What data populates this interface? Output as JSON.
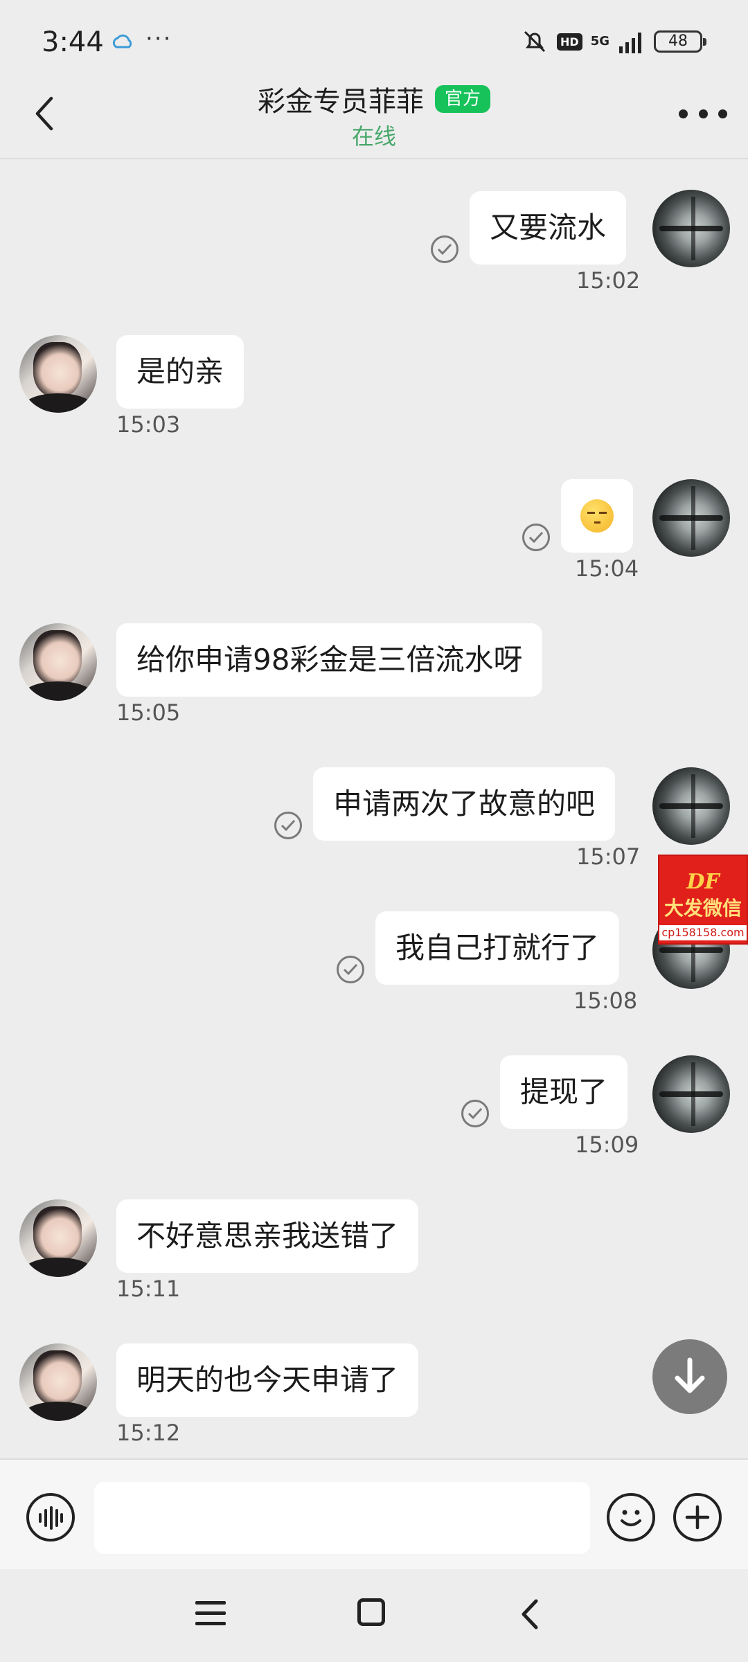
{
  "status_bar": {
    "time": "3:44",
    "dots": "···",
    "hd": "HD",
    "network": "5G",
    "battery": "48"
  },
  "header": {
    "title": "彩金专员菲菲",
    "badge": "官方",
    "subtitle": "在线"
  },
  "messages": [
    {
      "side": "right",
      "text": "又要流水",
      "time": "15:02",
      "read": true
    },
    {
      "side": "left",
      "text": "是的亲",
      "time": "15:03"
    },
    {
      "side": "right",
      "emoji": "smirk-face-emoji",
      "time": "15:04",
      "read": true
    },
    {
      "side": "left",
      "text": "给你申请98彩金是三倍流水呀",
      "time": "15:05"
    },
    {
      "side": "right",
      "text": "申请两次了故意的吧",
      "time": "15:07",
      "read": true
    },
    {
      "side": "right",
      "text": "我自己打就行了",
      "time": "15:08",
      "read": true
    },
    {
      "side": "right",
      "text": "提现了",
      "time": "15:09",
      "read": true
    },
    {
      "side": "left",
      "text": "不好意思亲我送错了",
      "time": "15:11"
    },
    {
      "side": "left",
      "text": "明天的也今天申请了",
      "time": "15:12"
    }
  ],
  "watermark": {
    "logo": "DF",
    "text": "大发微信",
    "url": "cp158158.com"
  },
  "input": {
    "value": "",
    "placeholder": ""
  },
  "colors": {
    "background": "#ededed",
    "bubble": "#ffffff",
    "badge": "#17c25b",
    "online": "#48a86b",
    "watermark": "#e1201c"
  }
}
